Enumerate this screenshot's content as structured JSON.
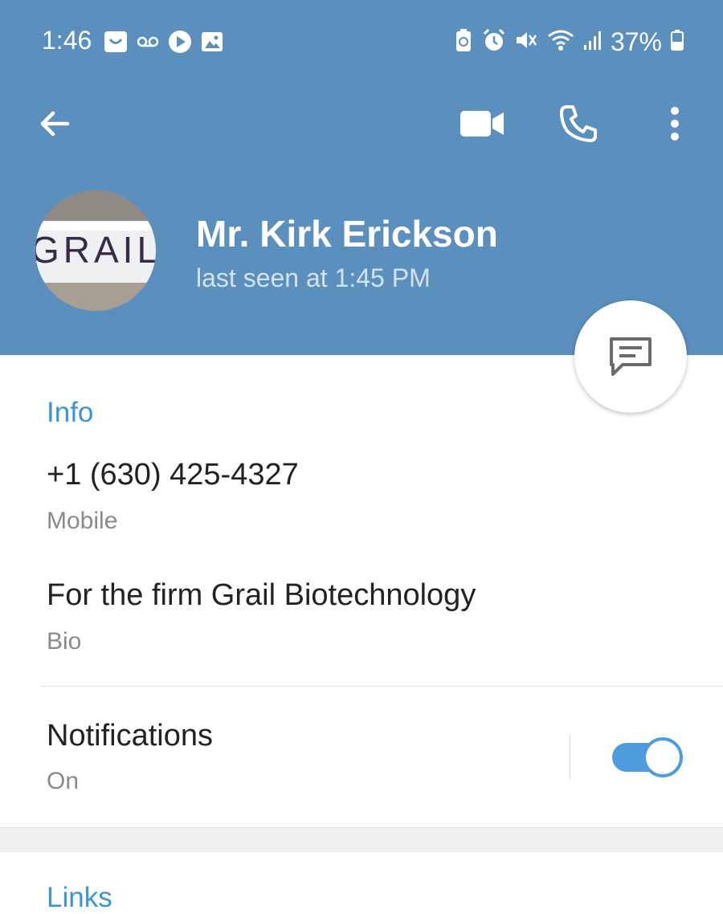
{
  "status_bar": {
    "time": "1:46",
    "battery_percent": "37%",
    "left_icons": [
      "bag-notification-icon",
      "voicemail-icon",
      "play-icon",
      "image-icon"
    ],
    "right_icons": [
      "battery-saver-icon",
      "alarm-icon",
      "mute-icon",
      "wifi-icon",
      "signal-icon",
      "battery-icon"
    ]
  },
  "toolbar": {
    "back_icon": "arrow-left-icon",
    "video_icon": "video-camera-icon",
    "call_icon": "phone-icon",
    "more_icon": "more-vertical-icon"
  },
  "profile": {
    "name": "Mr. Kirk Erickson",
    "last_seen": "last seen at 1:45 PM",
    "avatar_text": "GRAIL"
  },
  "fab": {
    "icon": "message-icon"
  },
  "info": {
    "title": "Info",
    "phone": "+1 (630) 425-4327",
    "phone_label": "Mobile",
    "bio": "For the firm Grail Biotechnology",
    "bio_label": "Bio",
    "notifications_label": "Notifications",
    "notifications_state": "On",
    "notifications_enabled": true
  },
  "links": {
    "title": "Links"
  },
  "colors": {
    "header": "#5b8fbd",
    "accent": "#3a95d3",
    "toggle": "#4e9cde"
  }
}
